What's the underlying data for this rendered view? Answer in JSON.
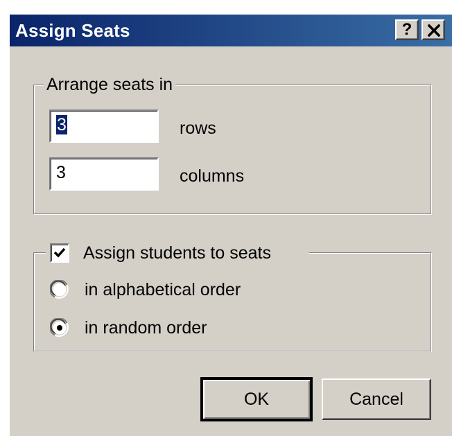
{
  "window": {
    "title": "Assign Seats",
    "help_label": "?",
    "close_icon": "close-icon"
  },
  "arrange": {
    "group_label": "Arrange seats in",
    "rows_value": "3",
    "rows_label": "rows",
    "columns_value": "3",
    "columns_label": "columns"
  },
  "assign": {
    "checkbox_label": "Assign students to seats",
    "checked": true,
    "options": [
      {
        "label": "in alphabetical order",
        "selected": false
      },
      {
        "label": "in random order",
        "selected": true
      }
    ]
  },
  "buttons": {
    "ok_label": "OK",
    "cancel_label": "Cancel"
  },
  "colors": {
    "title_bar_start": "#0a246a",
    "title_bar_end": "#3a6ea5",
    "dialog_face": "#d4d0c8",
    "selection": "#0a246a"
  }
}
